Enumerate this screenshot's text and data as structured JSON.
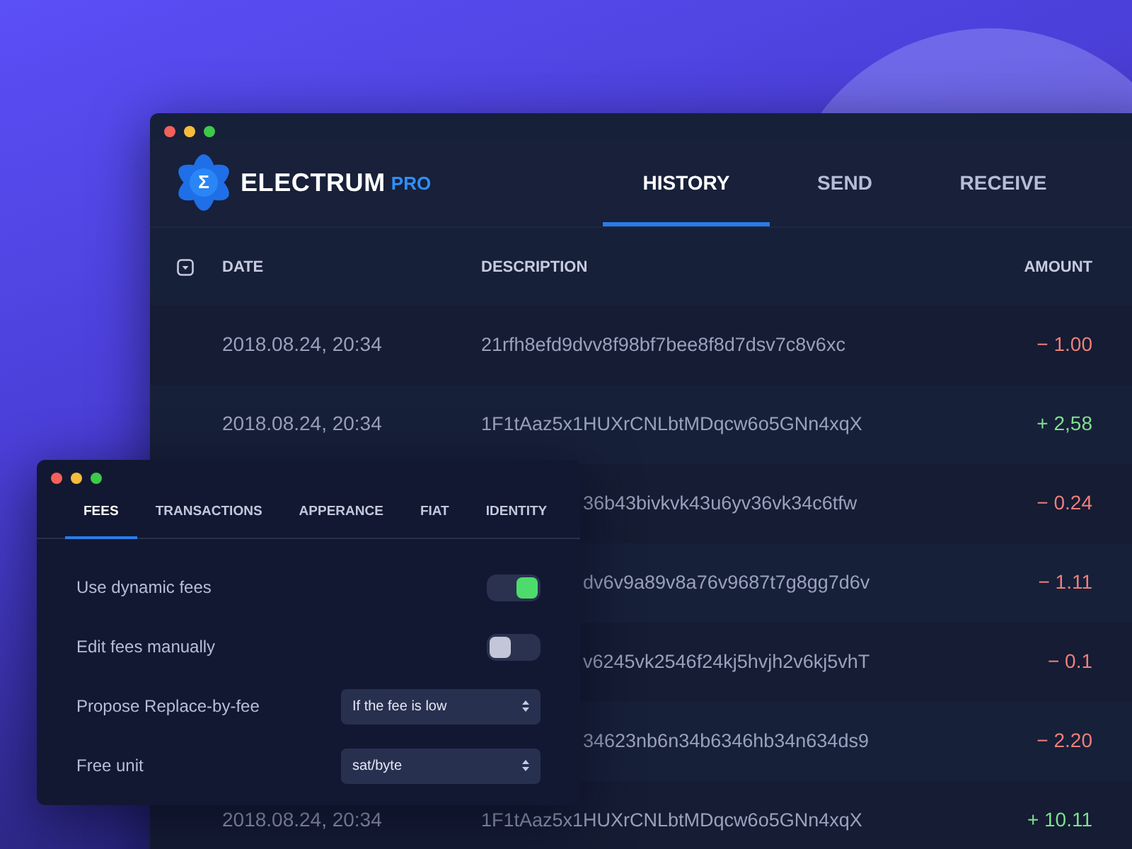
{
  "main_window": {
    "logo": {
      "glyph": "Σ",
      "name": "ELECTRUM",
      "suffix": "PRO"
    },
    "nav": [
      {
        "label": "HISTORY",
        "selected": true
      },
      {
        "label": "SEND",
        "selected": false
      },
      {
        "label": "RECEIVE",
        "selected": false
      }
    ],
    "table": {
      "columns": [
        "DATE",
        "DESCRIPTION",
        "AMOUNT"
      ],
      "rows": [
        {
          "date": "2018.08.24, 20:34",
          "description": "21rfh8efd9dvv8f98bf7bee8f8d7dsv7c8v6xc",
          "amount": "− 1.00",
          "color": "#ee7f7b"
        },
        {
          "date": "2018.08.24, 20:34",
          "description": "1F1tAaz5x1HUXrCNLbtMDqcw6o5GNn4xqX",
          "amount": "+ 2,58",
          "color": "#7ee08f"
        },
        {
          "description": "36b43bivkvk43u6yv36vk34c6tfw",
          "amount": "− 0.24",
          "color": "#ee7f7b"
        },
        {
          "description": "dv6v9a89v8a76v9687t7g8gg7d6v",
          "amount": "− 1.11",
          "color": "#ee7f7b"
        },
        {
          "description": "v6245vk2546f24kj5hvjh2v6kj5vhT",
          "amount": "− 0.1",
          "color": "#ee7f7b"
        },
        {
          "description": "34623nb6n34b6346hb34n634ds9",
          "amount": "− 2.20",
          "color": "#ee7f7b"
        },
        {
          "date": "2018.08.24, 20:34",
          "description": "1F1tAaz5x1HUXrCNLbtMDqcw6o5GNn4xqX",
          "amount": "+ 10.11",
          "color": "#7ee08f"
        }
      ]
    }
  },
  "settings_window": {
    "tabs": [
      {
        "label": "FEES",
        "selected": true
      },
      {
        "label": "TRANSACTIONS",
        "selected": false
      },
      {
        "label": "APPERANCE",
        "selected": false
      },
      {
        "label": "FIAT",
        "selected": false
      },
      {
        "label": "IDENTITY",
        "selected": false
      }
    ],
    "rows": [
      {
        "kind": "toggle",
        "label": "Use dynamic fees",
        "on": true
      },
      {
        "kind": "toggle",
        "label": "Edit fees manually",
        "on": false
      },
      {
        "kind": "select",
        "label": "Propose Replace-by-fee",
        "value": "If the fee is low"
      },
      {
        "kind": "select",
        "label": "Free unit",
        "value": "sat/byte"
      }
    ]
  }
}
